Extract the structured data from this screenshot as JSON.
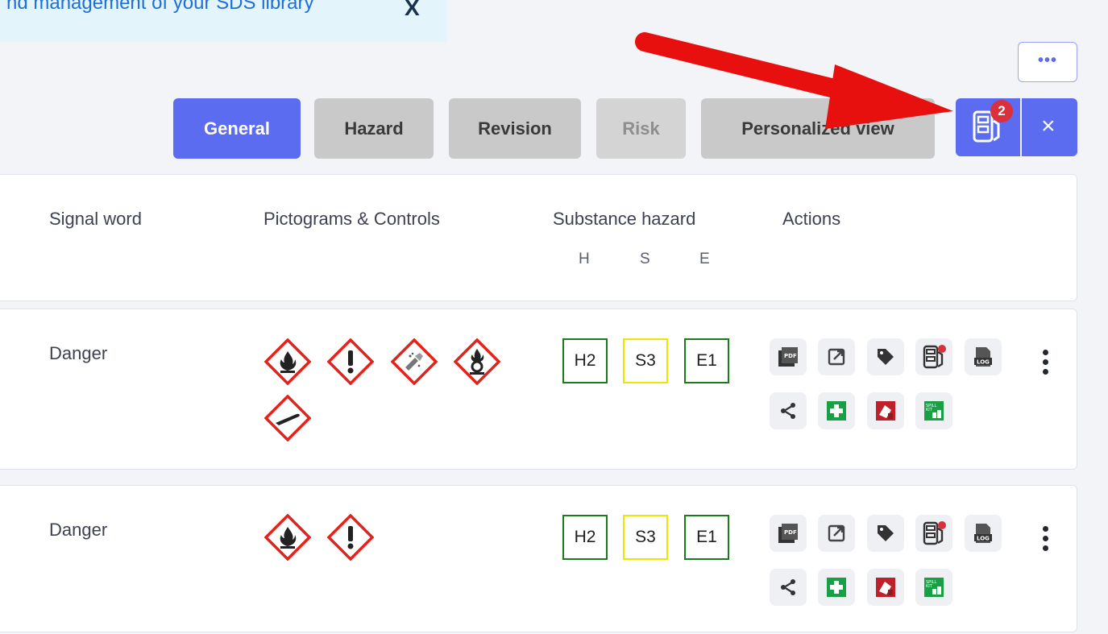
{
  "banner": {
    "text": "nd management of your SDS library",
    "close": "X"
  },
  "toolbar": {
    "more_label": "•••",
    "tabs": [
      "General",
      "Hazard",
      "Revision",
      "Risk",
      "Personalized view"
    ],
    "sds_badge": "2",
    "close_label": "×"
  },
  "header": {
    "signal_word": "Signal word",
    "pictograms": "Pictograms & Controls",
    "substance_hazard": "Substance hazard",
    "actions": "Actions",
    "sub_h": "H",
    "sub_s": "S",
    "sub_e": "E"
  },
  "rows": [
    {
      "signal": "Danger",
      "pictograms": [
        "flame-icon",
        "exclamation-icon",
        "corrosion-icon",
        "oxidizer-icon",
        "gas-cylinder-icon"
      ],
      "h": "H2",
      "s": "S3",
      "e": "E1"
    },
    {
      "signal": "Danger",
      "pictograms": [
        "flame-icon",
        "exclamation-icon"
      ],
      "h": "H2",
      "s": "S3",
      "e": "E1"
    }
  ],
  "colors": {
    "accent": "#5b6cf0",
    "badge": "#d9303b",
    "hazard_green": "#1c7a1c",
    "hazard_yellow": "#f0e500",
    "pictogram_red": "#e3231b",
    "arrow_red": "#e8100e"
  }
}
